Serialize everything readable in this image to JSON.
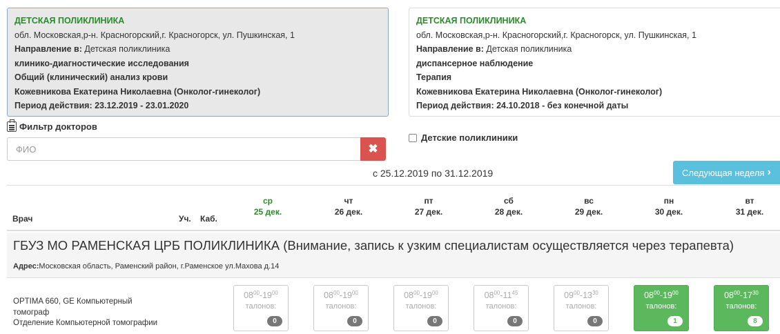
{
  "referrals": [
    {
      "org": "ДЕТСКАЯ ПОЛИКЛИНИКА",
      "address": "обл. Московская,р-н. Красногорский,г. Красногорск, ул. Пушкинская, 1",
      "direction_label": "Направление в:",
      "direction_value": " Детская поликлиника",
      "type": "клинико-диагностические исследования",
      "service": "Общий (клинический) анализ крови",
      "doctor": "Кожевникова Екатерина Николаевна (Онколог-гинеколог)",
      "period": "Период действия: 23.12.2019 - 23.01.2020"
    },
    {
      "org": "ДЕТСКАЯ ПОЛИКЛИНИКА",
      "address": "обл. Московская,р-н. Красногорский,г. Красногорск, ул. Пушкинская, 1",
      "direction_label": "Направление в:",
      "direction_value": " Детская поликлиника",
      "type": "диспансерное наблюдение",
      "service": "Терапия",
      "doctor": "Кожевникова Екатерина Николаевна (Онколог-гинеколог)",
      "period": "Период действия: 24.10.2018 - без конечной даты"
    }
  ],
  "filter": {
    "title": "Фильтр докторов",
    "placeholder": "ФИО",
    "clear_icon": "✖",
    "child_clinics_label": "Детские поликлиники"
  },
  "week": {
    "range": "с 25.12.2019 по 31.12.2019",
    "next_label": "Следующая неделя",
    "next_icon": "›"
  },
  "table": {
    "col_doctor": "Врач",
    "col_uch": "Уч.",
    "col_kab": "Каб.",
    "days": [
      {
        "name": "ср",
        "date": "25 дек."
      },
      {
        "name": "чт",
        "date": "26 дек."
      },
      {
        "name": "пт",
        "date": "27 дек."
      },
      {
        "name": "сб",
        "date": "28 дек."
      },
      {
        "name": "вс",
        "date": "29 дек."
      },
      {
        "name": "пн",
        "date": "30 дек."
      },
      {
        "name": "вт",
        "date": "31 дек."
      }
    ],
    "today_color": "#2b8a2b"
  },
  "clinic": {
    "name": "ГБУЗ МО РАМЕНСКАЯ ЦРБ ПОЛИКЛИНИКА (Внимание, запись к узким специалистам осуществляется через терапевта)",
    "address_label": "Адрес:",
    "address_value": "Московская область, Раменский район, г.Раменское ул.Махова д.14"
  },
  "doctor_row": {
    "device": "OPTIMA 660, GE Компьютерный томограф",
    "department": "Отделение Компьютерной томографии",
    "slots": [
      {
        "start": "08",
        "start_sup": "00",
        "end": "19",
        "end_sup": "00",
        "label": "талонов:",
        "count": "0",
        "active": false
      },
      {
        "start": "08",
        "start_sup": "00",
        "end": "19",
        "end_sup": "00",
        "label": "талонов:",
        "count": "0",
        "active": false
      },
      {
        "start": "08",
        "start_sup": "00",
        "end": "19",
        "end_sup": "00",
        "label": "талонов:",
        "count": "0",
        "active": false
      },
      {
        "start": "08",
        "start_sup": "00",
        "end": "11",
        "end_sup": "45",
        "label": "талонов:",
        "count": "0",
        "active": false
      },
      {
        "start": "09",
        "start_sup": "00",
        "end": "13",
        "end_sup": "30",
        "label": "талонов:",
        "count": "0",
        "active": false
      },
      {
        "start": "08",
        "start_sup": "00",
        "end": "19",
        "end_sup": "00",
        "label": "талонов:",
        "count": "1",
        "active": true
      },
      {
        "start": "08",
        "start_sup": "00",
        "end": "17",
        "end_sup": "30",
        "label": "талонов:",
        "count": "8",
        "active": true
      }
    ]
  },
  "colors": {
    "org_green": "#2b8a2b",
    "clear_red": "#d9534f",
    "next_blue": "#5bc0de",
    "slot_green": "#5cb85c"
  }
}
